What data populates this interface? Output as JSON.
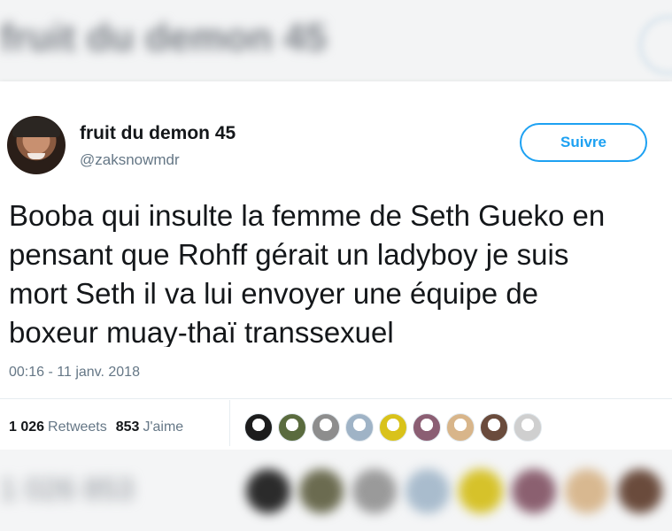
{
  "tweet": {
    "display_name": "fruit du demon 45",
    "handle": "@zaksnowmdr",
    "follow_label": "Suivre",
    "text": "Booba qui insulte la femme de Seth Gueko en\npensant que Rohff gérait un ladyboy je suis\nmort Seth il va lui envoyer une équipe de\nboxeur muay-thaï transsexuel",
    "timestamp": "00:16 - 11 janv. 2018",
    "retweets_count": "1 026",
    "retweets_label": "Retweets",
    "likes_count": "853",
    "likes_label": "J'aime"
  },
  "colors": {
    "accent": "#1da1f2",
    "secondary_text": "#657786",
    "primary_text": "#14171a"
  },
  "likers": [
    {
      "name": "liker-1",
      "color": "#1c1c1c"
    },
    {
      "name": "liker-2",
      "color": "#5a6b3e"
    },
    {
      "name": "liker-3",
      "color": "#8d8d8d"
    },
    {
      "name": "liker-4",
      "color": "#9fb3c6"
    },
    {
      "name": "liker-5",
      "color": "#d9c21a"
    },
    {
      "name": "liker-6",
      "color": "#8b5e73"
    },
    {
      "name": "liker-7",
      "color": "#d8b58a"
    },
    {
      "name": "liker-8",
      "color": "#6a4b3c"
    },
    {
      "name": "liker-9",
      "color": "#cfcfcf"
    }
  ]
}
